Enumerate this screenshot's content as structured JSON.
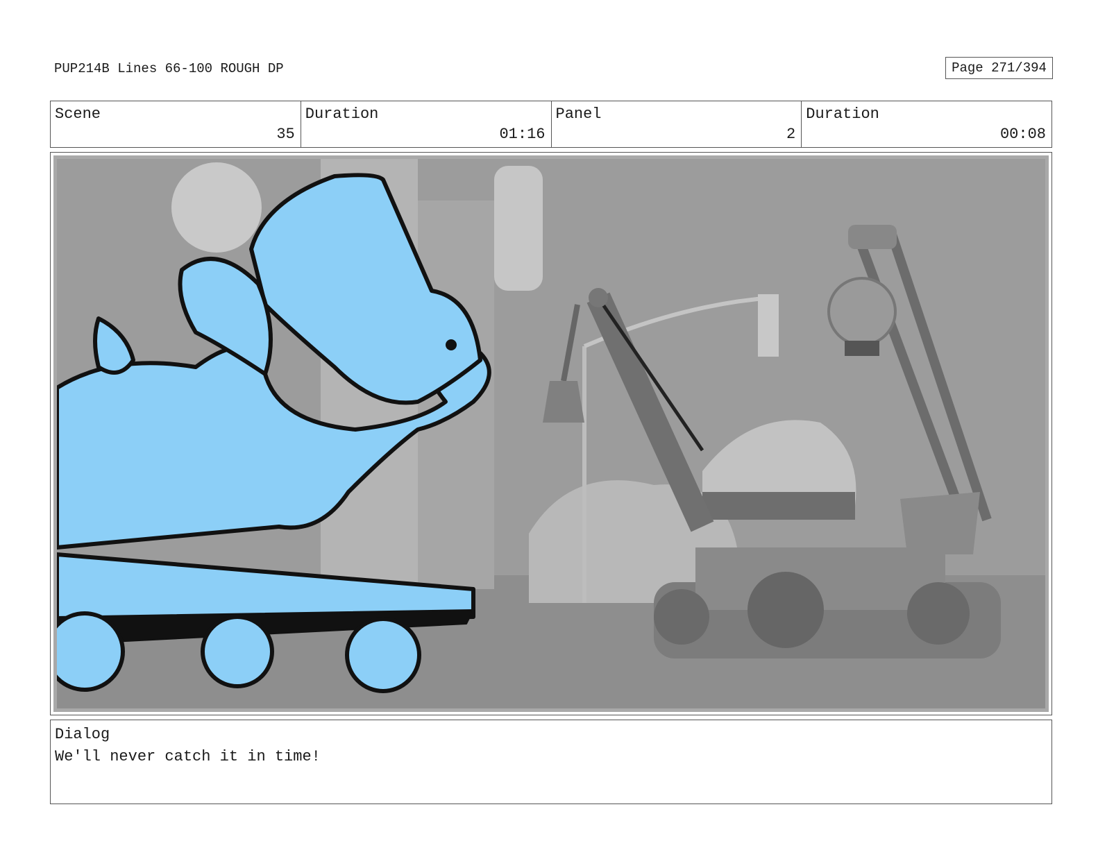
{
  "header": {
    "doc_title": "PUP214B Lines 66-100 ROUGH DP",
    "page": "Page 271/394"
  },
  "info": [
    {
      "label": "Scene",
      "value": "35"
    },
    {
      "label": "Duration",
      "value": "01:16"
    },
    {
      "label": "Panel",
      "value": "2"
    },
    {
      "label": "Duration",
      "value": "00:08"
    }
  ],
  "dialog": {
    "label": "Dialog",
    "text": "We'll never catch it in time!"
  },
  "colors": {
    "puppy_fill": "#8ccff7",
    "background_gray": "#9a9a9a",
    "ink": "#111111"
  }
}
